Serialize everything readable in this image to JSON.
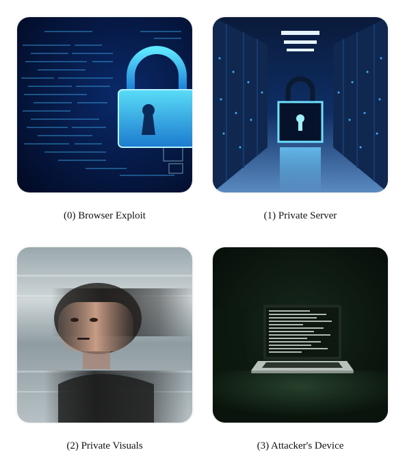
{
  "panels": [
    {
      "caption": "(0) Browser Exploit",
      "icon": "digital-padlock-icon"
    },
    {
      "caption": "(1) Private Server",
      "icon": "server-padlock-icon"
    },
    {
      "caption": "(2) Private Visuals",
      "icon": "blurred-portrait-image"
    },
    {
      "caption": "(3) Attacker's Device",
      "icon": "laptop-icon"
    }
  ],
  "colors": {
    "cyber_dark": "#031033",
    "lock_glow": "#3fd0ff",
    "server_blue": "#1f78d8",
    "mist_gray": "#b9c3c7",
    "room_dark": "#0d1a12",
    "terminal_green": "#d9e6dc"
  }
}
